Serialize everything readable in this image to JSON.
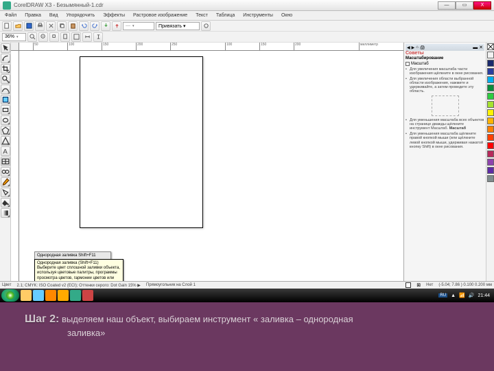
{
  "window": {
    "title": "CorelDRAW X3 - Безымянный-1.cdr"
  },
  "win_buttons": {
    "min": "—",
    "max": "▭",
    "close": "X"
  },
  "menu": [
    "Файл",
    "Правка",
    "Вид",
    "Упорядочить",
    "Эффекты",
    "Растровое изображение",
    "Текст",
    "Таблица",
    "Инструменты",
    "Окно"
  ],
  "toolbar2": {
    "zoom": "36%",
    "units_combo": "миллиме",
    "snap_combo": "Привязать ▾"
  },
  "ruler_marks": [
    "50",
    "100",
    "150",
    "200",
    "250",
    "100",
    "150",
    "200"
  ],
  "ruler_end": "миллиметр",
  "tooltip_bar": "Однородная заливка   Shift+F11",
  "tooltip_text": "Однородная заливка (Shift+F11)\nВыберите цвет сплошной заливки объекта,\nиспользуя цветовые палитры, программы\nпросмотра цветов, гармонии цветов или\nпалитры.",
  "hints": {
    "panel_title": "Советы",
    "section": "Масштабирование",
    "check": "Масштаб",
    "items1": [
      "Для увеличения масштаба части изображения щёлкните в окне рисования.",
      "Для увеличения области выбранной области изображения, нажмите и удерживайте, а затем проведите эту область."
    ],
    "items2": [
      "Для уменьшения масштаба всех объектов на странице дважды щёлкните инструмент Масштаб.",
      "Для уменьшения масштаба щёлкните правой кнопкой мыши (или щёлкните левой кнопкой мыши, удерживая нажатой кнопку Shift) в окне рисования."
    ],
    "bold_tool": "Масштаб"
  },
  "status": {
    "left_label": "Цвет",
    "mid": "2.1; CMYK: ISO Coated v2 (ECI); Оттенки серого: Dot Gain 15% ▶",
    "fill_none": "Нет",
    "coords": "(-5.04; 7.86 ) 0.100  0.200 мм",
    "bottom_label": "Прямоугольник на Слой 1"
  },
  "colors": [
    "#ffffff",
    "#000000",
    "#1a2a6c",
    "#2c3e9f",
    "#00aeef",
    "#0b8c3b",
    "#2ecc40",
    "#a6e22e",
    "#fff200",
    "#ffb400",
    "#ff7f00",
    "#ff4000",
    "#ff0000",
    "#b7295a",
    "#8e44ad",
    "#5e2ca5",
    "#7f8c8d"
  ],
  "tray": {
    "lang": "RU",
    "time": "21:44"
  },
  "caption": {
    "step": "Шаг 2:",
    "line1": "выделяем наш объект, выбираем инструмент « заливка – однородная",
    "line2": "заливка»"
  }
}
